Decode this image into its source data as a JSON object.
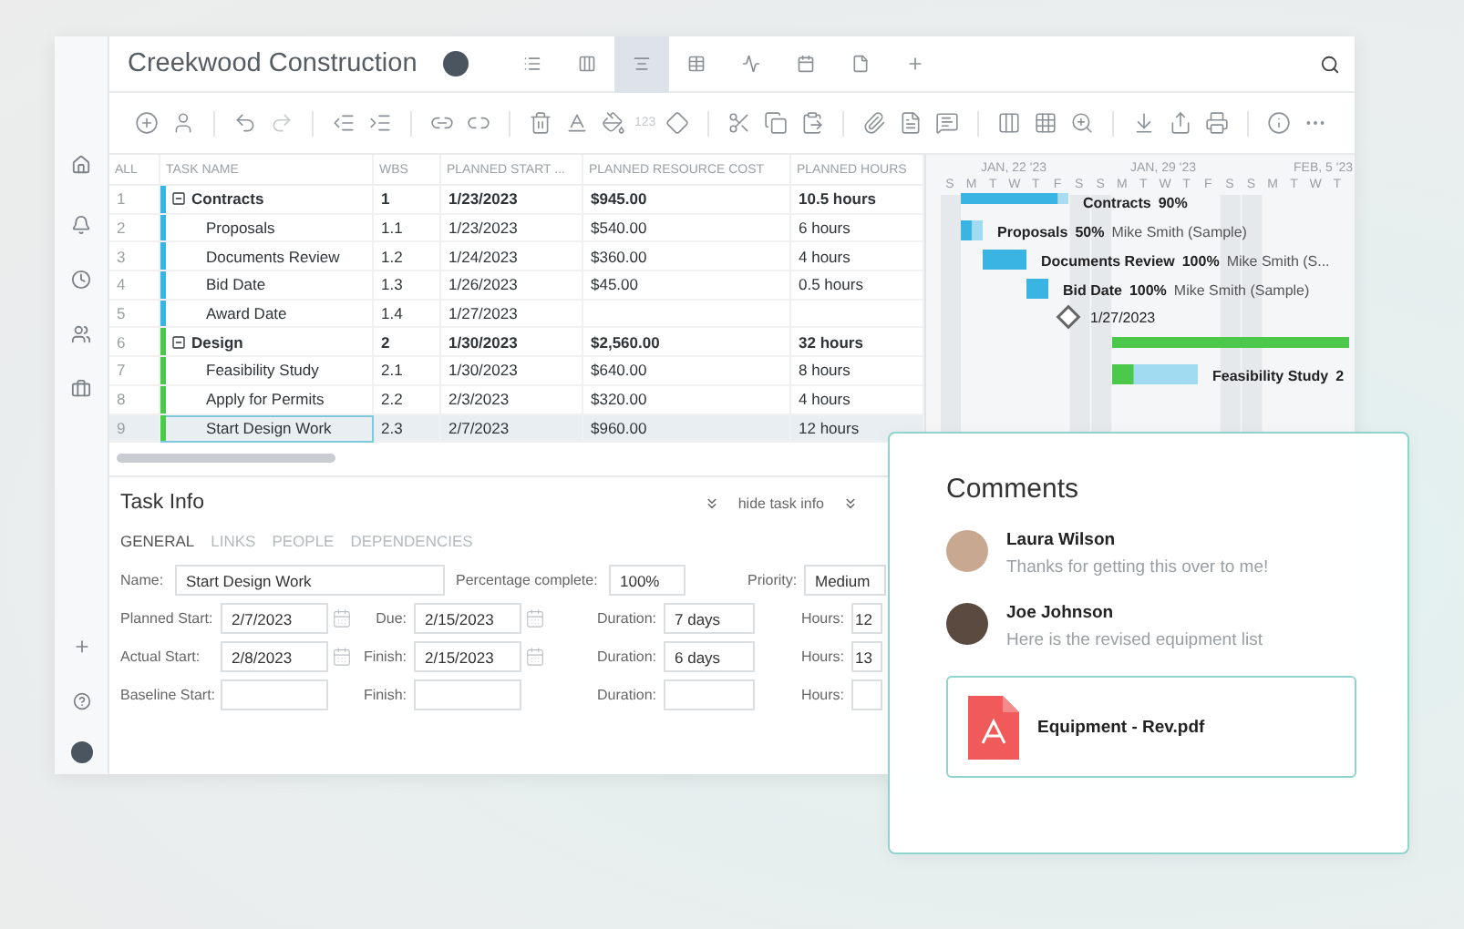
{
  "header": {
    "title": "Creekwood Construction",
    "views": [
      {
        "selected": false
      },
      {
        "selected": false
      },
      {
        "selected": true
      },
      {
        "selected": false
      },
      {
        "selected": false
      },
      {
        "selected": false
      },
      {
        "selected": false
      },
      {
        "selected": false
      }
    ]
  },
  "toolbar": {
    "number_format_label": "123"
  },
  "table": {
    "columns": [
      "ALL",
      "TASK NAME",
      "WBS",
      "PLANNED START ...",
      "PLANNED RESOURCE COST",
      "PLANNED HOURS"
    ],
    "groups": [
      {
        "num": "1",
        "name": "Contracts",
        "wbs": "1",
        "start": "1/23/2023",
        "cost": "$945.00",
        "hours": "10.5 hours",
        "expanded": true,
        "selected": false,
        "color": "#3ab4e2",
        "children": [
          {
            "num": "2",
            "name": "Proposals",
            "wbs": "1.1",
            "start": "1/23/2023",
            "cost": "$540.00",
            "hours": "6 hours",
            "selected": false
          },
          {
            "num": "3",
            "name": "Documents Review",
            "wbs": "1.2",
            "start": "1/24/2023",
            "cost": "$360.00",
            "hours": "4 hours",
            "selected": false
          },
          {
            "num": "4",
            "name": "Bid Date",
            "wbs": "1.3",
            "start": "1/26/2023",
            "cost": "$45.00",
            "hours": "0.5 hours",
            "selected": false
          },
          {
            "num": "5",
            "name": "Award Date",
            "wbs": "1.4",
            "start": "1/27/2023",
            "selected": false
          }
        ]
      },
      {
        "num": "6",
        "name": "Design",
        "wbs": "2",
        "start": "1/30/2023",
        "cost": "$2,560.00",
        "hours": "32 hours",
        "expanded": true,
        "selected": false,
        "color": "#4cc94a",
        "children": [
          {
            "num": "7",
            "name": "Feasibility Study",
            "wbs": "2.1",
            "start": "1/30/2023",
            "cost": "$640.00",
            "hours": "8 hours",
            "selected": false
          },
          {
            "num": "8",
            "name": "Apply for Permits",
            "wbs": "2.2",
            "start": "2/3/2023",
            "cost": "$320.00",
            "hours": "4 hours",
            "selected": false
          },
          {
            "num": "9",
            "name": "Start Design Work",
            "wbs": "2.3",
            "start": "2/7/2023",
            "cost": "$960.00",
            "hours": "12 hours",
            "selected": true
          }
        ]
      }
    ]
  },
  "gantt": {
    "weeks": [
      "JAN, 22 '23",
      "JAN, 29 '23",
      "FEB, 5 '23"
    ],
    "days": [
      "S",
      "M",
      "T",
      "W",
      "T",
      "F",
      "S",
      "S",
      "M",
      "T",
      "W",
      "T",
      "F",
      "S",
      "S",
      "M",
      "T",
      "W",
      "T"
    ],
    "bars": [
      {
        "kind": "summary",
        "name": "Contracts",
        "percent": "90%",
        "level": 0.9,
        "color": "#3ab4e2"
      },
      {
        "kind": "task",
        "name": "Proposals",
        "percent": "50%",
        "assignee": "Mike Smith (Sample)",
        "level": 0.5,
        "color": "#3ab4e2"
      },
      {
        "kind": "task",
        "name": "Documents Review",
        "percent": "100%",
        "assignee": "Mike Smith (S...",
        "level": 1,
        "color": "#3ab4e2"
      },
      {
        "kind": "task",
        "name": "Bid Date",
        "percent": "100%",
        "assignee": "Mike Smith (Sample)",
        "level": 1,
        "color": "#3ab4e2"
      },
      {
        "kind": "milestone",
        "name": "1/27/2023"
      },
      {
        "kind": "summary",
        "level": 1,
        "color": "#4cc94a"
      },
      {
        "kind": "task",
        "name": "Feasibility Study",
        "percent": "2",
        "level": 0.25,
        "color": "#4cc94a"
      }
    ]
  },
  "task_info": {
    "title": "Task Info",
    "hide_label": "hide task info",
    "tabs": [
      {
        "label": "GENERAL",
        "selected": true
      },
      {
        "label": "LINKS",
        "selected": false
      },
      {
        "label": "PEOPLE",
        "selected": false
      },
      {
        "label": "DEPENDENCIES",
        "selected": false
      }
    ],
    "name_row": [
      {
        "label": "Name:",
        "value": "Start Design Work"
      },
      {
        "label": "Percentage complete:",
        "value": "100%"
      },
      {
        "label": "Priority:",
        "value": "Medium"
      }
    ],
    "date_rows": [
      [
        {
          "label": "Planned Start:",
          "value": "2/7/2023",
          "kind": "date"
        },
        {
          "label": "Due:",
          "value": "2/15/2023",
          "kind": "date"
        },
        {
          "label": "Duration:",
          "value": "7 days",
          "kind": "text"
        },
        {
          "label": "Hours:",
          "value": "12",
          "kind": "text"
        }
      ],
      [
        {
          "label": "Actual Start:",
          "value": "2/8/2023",
          "kind": "date"
        },
        {
          "label": "Finish:",
          "value": "2/15/2023",
          "kind": "date"
        },
        {
          "label": "Duration:",
          "value": "6 days",
          "kind": "text"
        },
        {
          "label": "Hours:",
          "value": "13",
          "kind": "text"
        }
      ],
      [
        {
          "label": "Baseline Start:",
          "kind": "text"
        },
        {
          "label": "Finish:",
          "kind": "text"
        },
        {
          "label": "Duration:",
          "kind": "text"
        },
        {
          "label": "Hours:",
          "kind": "text"
        }
      ]
    ]
  },
  "comments": {
    "title": "Comments",
    "items": [
      {
        "author": "Laura Wilson",
        "text": "Thanks for getting this over to me!"
      },
      {
        "author": "Joe Johnson",
        "text": "Here is the revised equipment list"
      }
    ],
    "attachment": {
      "name": "Equipment - Rev.pdf"
    }
  }
}
